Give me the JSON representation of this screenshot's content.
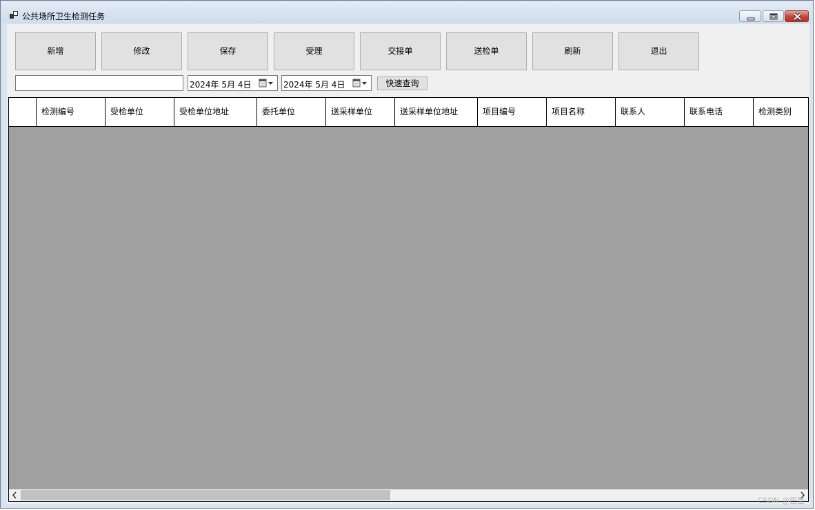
{
  "window": {
    "title": "公共场所卫生检测任务"
  },
  "toolbar": {
    "buttons": [
      "新增",
      "修改",
      "保存",
      "受理",
      "交接单",
      "送检单",
      "刷新",
      "退出"
    ]
  },
  "filter": {
    "search_value": "",
    "date_from": "2024年  5月  4日",
    "date_to": "2024年  5月  4日",
    "quick_query_label": "快速查询"
  },
  "grid": {
    "columns": [
      "检测编号",
      "受检单位",
      "受检单位地址",
      "委托单位",
      "送采样单位",
      "送采样单位地址",
      "项目编号",
      "项目名称",
      "联系人",
      "联系电话",
      "检测类别"
    ],
    "rows": []
  },
  "watermark": "CSDN @巴里",
  "colors": {
    "title_gradient_top": "#e3ecf7",
    "client_bg": "#f0f0f0",
    "grid_empty_bg": "#a0a0a0",
    "close_button": "#c8443a"
  },
  "icons": {
    "app": "app-icon",
    "minimize": "minimize-icon",
    "maximize": "maximize-icon",
    "close": "close-icon",
    "calendar": "calendar-icon",
    "dropdown": "chevron-down-icon",
    "scroll_left": "arrow-left-icon",
    "scroll_right": "arrow-right-icon"
  }
}
